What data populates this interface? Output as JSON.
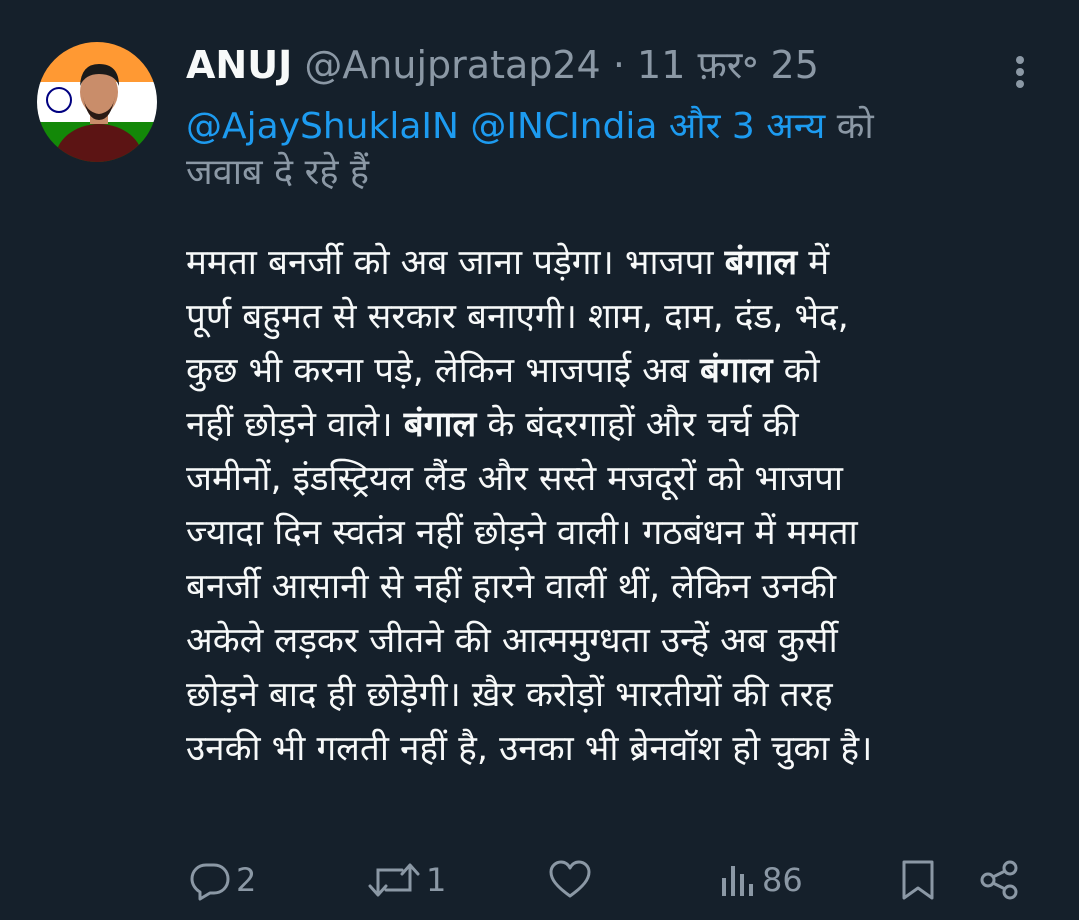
{
  "author": {
    "name": "ANUJ",
    "handle": "@Anujpratap24",
    "separator": "·",
    "date": "11 फ़र॰ 25"
  },
  "reply_to": {
    "mention1": "@AjayShuklaIN",
    "mention2": "@INCIndia",
    "others": "और 3 अन्य",
    "text_line1_end": "को",
    "text_line2": "जवाब दे रहे हैं"
  },
  "body": {
    "l1a": "ममता बनर्जी को अब जाना पड़ेगा। भाजपा ",
    "l1b": "बंगाल",
    "l1c": " में",
    "l2": "पूर्ण बहुमत से सरकार बनाएगी। शाम, दाम, दंड, भेद,",
    "l3a": "कुछ भी करना पड़े, लेकिन भाजपाई अब ",
    "l3b": "बंगाल",
    "l3c": " को",
    "l4a": "नहीं छोड़ने वाले। ",
    "l4b": "बंगाल",
    "l4c": " के बंदरगाहों और चर्च की",
    "l5": "जमीनों, इंडस्ट्रियल लैंड और सस्ते मजदूरों को भाजपा",
    "l6": "ज्यादा दिन स्वतंत्र नहीं छोड़ने वाली। गठबंधन में ममता",
    "l7": "बनर्जी आसानी से नहीं हारने वालीं थीं, लेकिन उनकी",
    "l8": "अकेले लड़कर जीतने की आत्ममुग्धता उन्हें अब कुर्सी",
    "l9": "छोड़ने बाद ही छोड़ेगी। ख़ैर करोड़ों भारतीयों की तरह",
    "l10": "उनकी भी गलती नहीं है, उनका भी ब्रेनवॉश हो चुका है।"
  },
  "actions": {
    "replies": "2",
    "reposts": "1",
    "views": "86"
  },
  "colors": {
    "background": "#15202b",
    "text": "#f7f9f9",
    "secondary": "#8b98a5",
    "link": "#1d9bf0"
  },
  "icons": [
    "more-icon",
    "reply-icon",
    "repost-icon",
    "like-icon",
    "views-icon",
    "bookmark-icon",
    "share-icon"
  ]
}
